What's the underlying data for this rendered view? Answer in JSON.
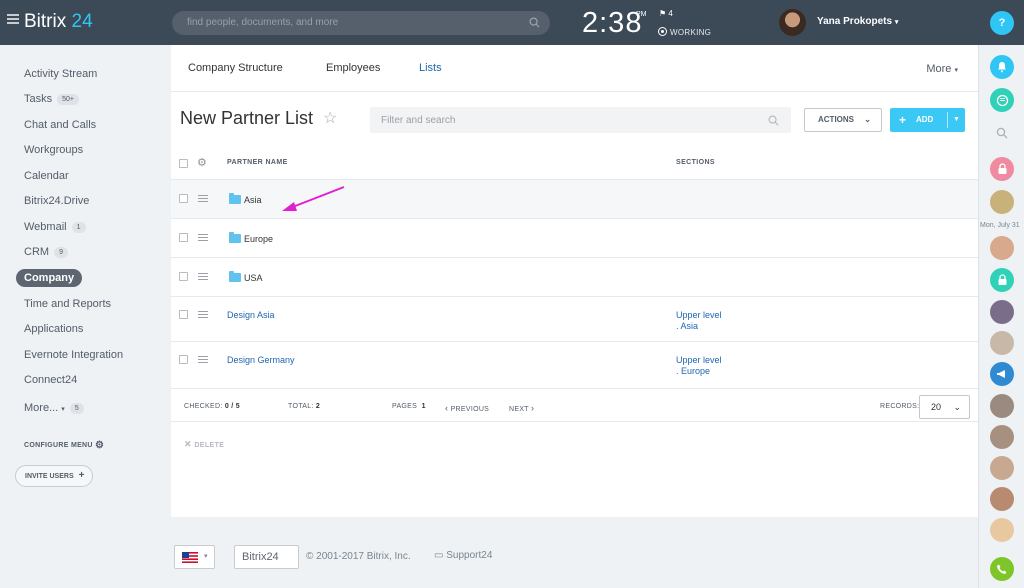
{
  "header": {
    "logo_text": "Bitrix",
    "logo_num": "24",
    "search_placeholder": "find people, documents, and more",
    "time": "2:38",
    "time_suffix": "PM",
    "flag_count": "4",
    "status": "WORKING",
    "user_name": "Yana Prokopets"
  },
  "sidebar": {
    "items": [
      {
        "label": "Activity Stream",
        "badge": ""
      },
      {
        "label": "Tasks",
        "badge": "50+"
      },
      {
        "label": "Chat and Calls",
        "badge": ""
      },
      {
        "label": "Workgroups",
        "badge": ""
      },
      {
        "label": "Calendar",
        "badge": ""
      },
      {
        "label": "Bitrix24.Drive",
        "badge": ""
      },
      {
        "label": "Webmail",
        "badge": "1"
      },
      {
        "label": "CRM",
        "badge": "9"
      },
      {
        "label": "Company",
        "badge": ""
      },
      {
        "label": "Time and Reports",
        "badge": ""
      },
      {
        "label": "Applications",
        "badge": ""
      },
      {
        "label": "Evernote Integration",
        "badge": ""
      },
      {
        "label": "Connect24",
        "badge": ""
      },
      {
        "label": "More...",
        "badge": "5"
      }
    ],
    "configure_label": "CONFIGURE MENU",
    "invite_label": "INVITE USERS"
  },
  "tabs": {
    "items": [
      "Company Structure",
      "Employees",
      "Lists"
    ],
    "active": "Lists",
    "more_label": "More"
  },
  "toolbar": {
    "title": "New Partner List",
    "filter_placeholder": "Filter and search",
    "actions_label": "ACTIONS",
    "add_label": "ADD"
  },
  "grid": {
    "columns": [
      "PARTNER NAME",
      "SECTIONS"
    ],
    "rows": [
      {
        "name": "Asia",
        "type": "folder",
        "section_line1": "",
        "section_line2": ""
      },
      {
        "name": "Europe",
        "type": "folder",
        "section_line1": "",
        "section_line2": ""
      },
      {
        "name": "USA",
        "type": "folder",
        "section_line1": "",
        "section_line2": ""
      },
      {
        "name": "Design Asia",
        "type": "item",
        "section_line1": "Upper level",
        "section_line2": ". Asia"
      },
      {
        "name": "Design Germany",
        "type": "item",
        "section_line1": "Upper level",
        "section_line2": ". Europe"
      }
    ],
    "footer": {
      "checked_label": "CHECKED:",
      "checked_value": "0 / 5",
      "total_label": "TOTAL:",
      "total_value": "2",
      "pages_label": "PAGES",
      "pages_value": "1",
      "previous_label": "PREVIOUS",
      "next_label": "NEXT",
      "records_label": "RECORDS:",
      "records_value": "20"
    },
    "delete_label": "DELETE"
  },
  "right_panel": {
    "help_label": "?",
    "date_label": "Mon, July 31"
  },
  "page_footer": {
    "bitrix_label": "Bitrix24",
    "copyright": "© 2001-2017 Bitrix, Inc.",
    "support_label": "Support24"
  },
  "colors": {
    "header_bg": "#3c4957",
    "accent_blue": "#2fc6f6",
    "link_blue": "#2067b0",
    "add_button": "#3bc8f5",
    "annotation_arrow": "#e020d0"
  }
}
